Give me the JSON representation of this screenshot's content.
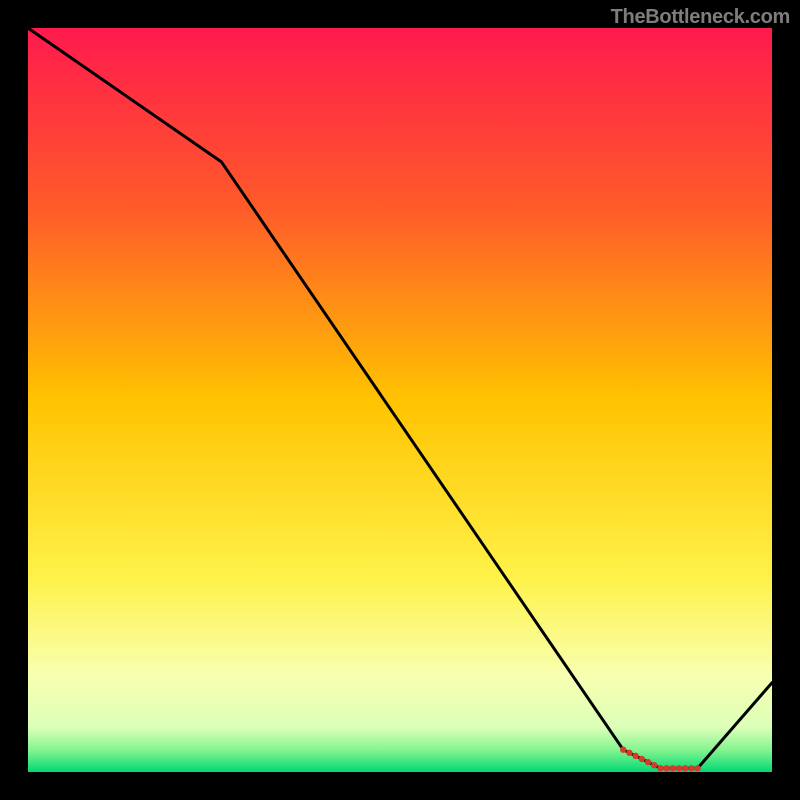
{
  "attribution": "TheBottleneck.com",
  "chart_data": {
    "type": "line",
    "title": "",
    "xlabel": "",
    "ylabel": "",
    "xlim": [
      0,
      100
    ],
    "ylim": [
      0,
      100
    ],
    "x": [
      0,
      26,
      80,
      85,
      90,
      100
    ],
    "values": [
      100,
      82,
      3,
      0.5,
      0.5,
      12
    ],
    "highlight_segment": {
      "x_start": 80,
      "x_end": 90
    },
    "background_gradient_stops": [
      {
        "pct": 0,
        "color": "#ff1a4d"
      },
      {
        "pct": 24,
        "color": "#ff5a2a"
      },
      {
        "pct": 50,
        "color": "#ffc300"
      },
      {
        "pct": 74,
        "color": "#fff24a"
      },
      {
        "pct": 87,
        "color": "#f8ffb0"
      },
      {
        "pct": 94,
        "color": "#dcffb8"
      },
      {
        "pct": 97,
        "color": "#86f590"
      },
      {
        "pct": 100,
        "color": "#00d874"
      }
    ]
  }
}
